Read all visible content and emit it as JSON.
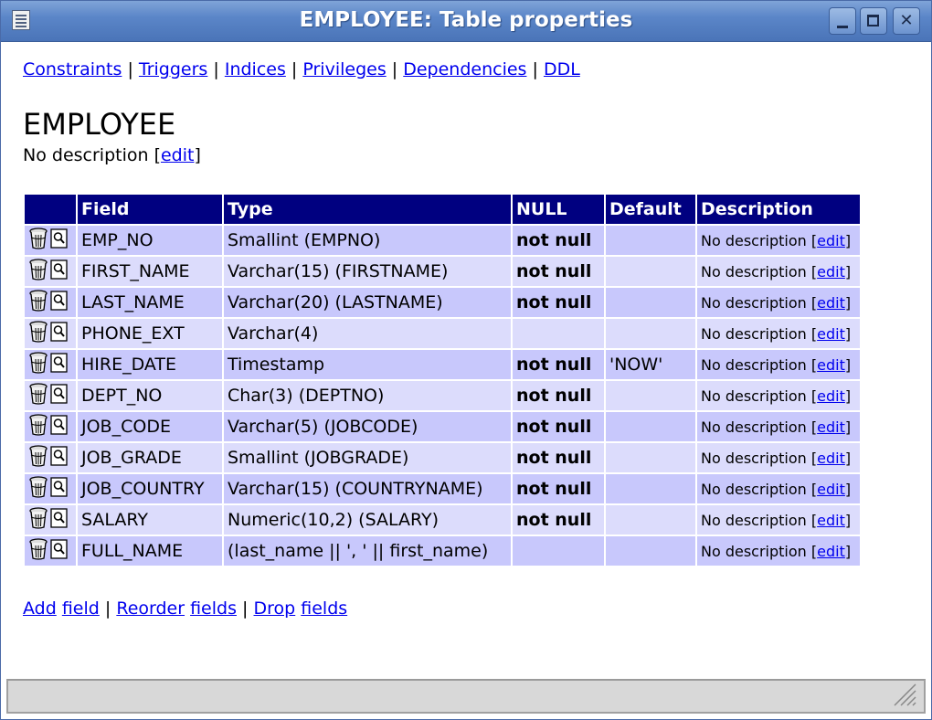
{
  "window": {
    "title": "EMPLOYEE: Table properties"
  },
  "nav": {
    "links": [
      "Constraints",
      "Triggers",
      "Indices",
      "Privileges",
      "Dependencies",
      "DDL"
    ],
    "separator": "|"
  },
  "table": {
    "name": "EMPLOYEE",
    "description": "No description",
    "edit_label": "edit"
  },
  "columns": [
    "",
    "Field",
    "Type",
    "NULL",
    "Default",
    "Description"
  ],
  "rows": [
    {
      "field": "EMP_NO",
      "type": "Smallint (EMPNO)",
      "null": "not null",
      "default": "",
      "description": "No description"
    },
    {
      "field": "FIRST_NAME",
      "type": "Varchar(15) (FIRSTNAME)",
      "null": "not null",
      "default": "",
      "description": "No description"
    },
    {
      "field": "LAST_NAME",
      "type": "Varchar(20) (LASTNAME)",
      "null": "not null",
      "default": "",
      "description": "No description"
    },
    {
      "field": "PHONE_EXT",
      "type": "Varchar(4)",
      "null": "",
      "default": "",
      "description": "No description"
    },
    {
      "field": "HIRE_DATE",
      "type": "Timestamp",
      "null": "not null",
      "default": "'NOW'",
      "description": "No description"
    },
    {
      "field": "DEPT_NO",
      "type": "Char(3) (DEPTNO)",
      "null": "not null",
      "default": "",
      "description": "No description"
    },
    {
      "field": "JOB_CODE",
      "type": "Varchar(5) (JOBCODE)",
      "null": "not null",
      "default": "",
      "description": "No description"
    },
    {
      "field": "JOB_GRADE",
      "type": "Smallint (JOBGRADE)",
      "null": "not null",
      "default": "",
      "description": "No description"
    },
    {
      "field": "JOB_COUNTRY",
      "type": "Varchar(15) (COUNTRYNAME)",
      "null": "not null",
      "default": "",
      "description": "No description"
    },
    {
      "field": "SALARY",
      "type": "Numeric(10,2) (SALARY)",
      "null": "not null",
      "default": "",
      "description": "No description"
    },
    {
      "field": "FULL_NAME",
      "type": "(last_name || ', ' || first_name)",
      "null": "",
      "default": "",
      "description": "No description"
    }
  ],
  "row_icons": [
    "trash-icon",
    "view-icon"
  ],
  "actions": {
    "add": "Add",
    "field": "field",
    "reorder": "Reorder",
    "fields": "fields",
    "drop": "Drop"
  },
  "colors": {
    "header_bg": "#000080",
    "row_odd": "#c8c8fc",
    "row_even": "#dcdcfc",
    "link": "#0000ee",
    "titlebar": "#5b86c8"
  }
}
